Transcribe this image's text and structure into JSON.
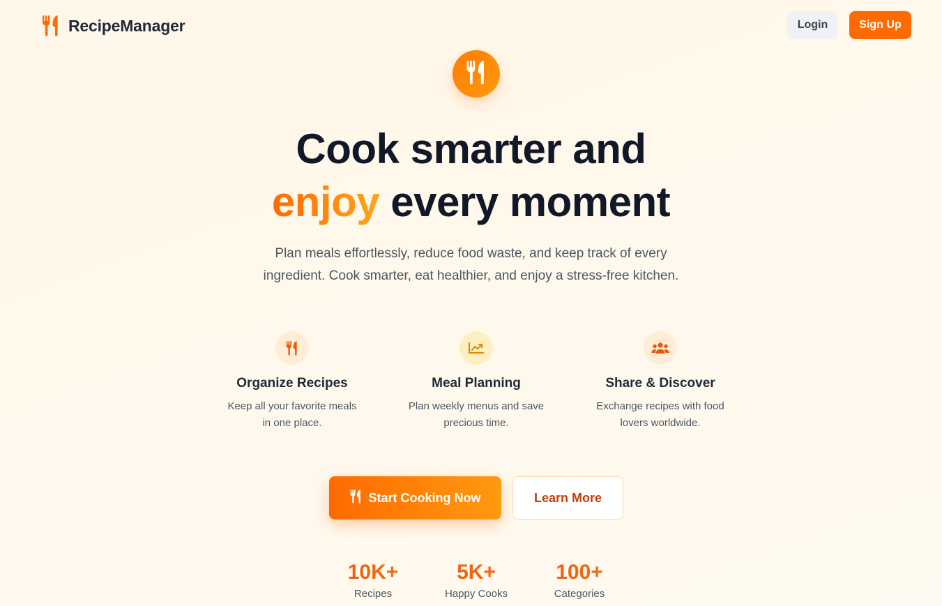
{
  "nav": {
    "brand_name": "RecipeManager",
    "brand_icon": "utensils-icon",
    "login_label": "Login",
    "signup_label": "Sign Up"
  },
  "hero": {
    "badge_icon": "utensils-icon",
    "headline_line1": "Cook smarter and",
    "headline_accent": "enjoy",
    "headline_rest": " every moment",
    "subtext": "Plan meals effortlessly, reduce food waste, and keep track of every ingredient. Cook smarter, eat healthier, and enjoy a stress-free kitchen."
  },
  "features": [
    {
      "icon": "utensils-icon",
      "title": "Organize Recipes",
      "desc": "Keep all your favorite meals in one place."
    },
    {
      "icon": "chart-line-icon",
      "title": "Meal Planning",
      "desc": "Plan weekly menus and save precious time."
    },
    {
      "icon": "users-icon",
      "title": "Share & Discover",
      "desc": "Exchange recipes with food lovers worldwide."
    }
  ],
  "cta": {
    "start_label": "Start Cooking Now",
    "learn_label": "Learn More"
  },
  "stats": [
    {
      "value": "10K+",
      "label": "Recipes"
    },
    {
      "value": "5K+",
      "label": "Happy Cooks"
    },
    {
      "value": "100+",
      "label": "Categories"
    }
  ],
  "colors": {
    "accent": "#ff6b00",
    "accent_light": "#ffa51a",
    "background": "#fff7e9",
    "heading": "#111827",
    "body_text": "#4b5563"
  }
}
